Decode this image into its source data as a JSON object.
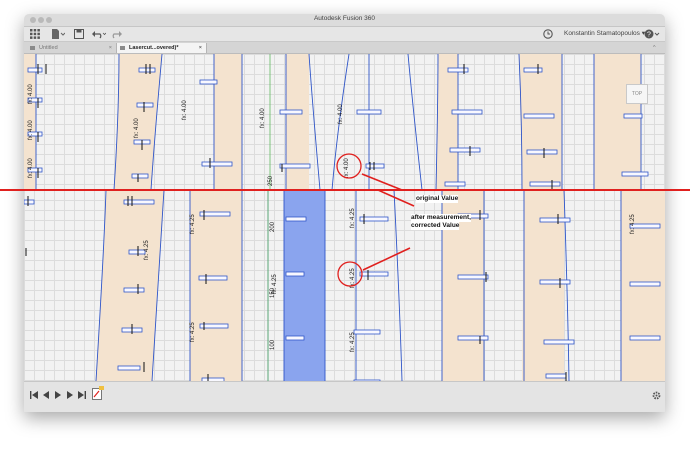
{
  "window": {
    "title": "Autodesk Fusion 360"
  },
  "toolbar": {
    "grid_icon": "grid-icon",
    "file_icon": "file-icon",
    "save_icon": "save-icon",
    "undo_icon": "undo-icon",
    "redo_icon": "redo-icon",
    "clock_icon": "clock-icon",
    "user_name": "Konstantin Stamatopoulos ▾",
    "help_icon": "help-icon"
  },
  "tabs": [
    {
      "label": "Untitled",
      "active": false
    },
    {
      "label": "Lasercut...overed)*",
      "active": true
    }
  ],
  "tab_close": "×",
  "tab_overflow": "^",
  "viewcube": {
    "label": "TOP"
  },
  "annotations": {
    "original": "original Value",
    "corrected_line1": "after measurement,",
    "corrected_line2": "corrected Value"
  },
  "dimensions": {
    "top": [
      "fx: 4.00",
      "fx: 4.00",
      "fx: 4.00",
      "fx: 4.00",
      "fx: 4.00",
      "fx: 4.00",
      "fx: 4.00",
      "fx: 4.00",
      "250"
    ],
    "bottom": [
      "fx: 4.25",
      "fx: 4.25",
      "fx: 4.25",
      "fx: 4.25",
      "fx: 4.25",
      "fx: 4.25",
      "fx: 4.25",
      "fx: 4.25",
      "200",
      "150",
      "100"
    ]
  },
  "colors": {
    "accent_red": "#e0201e",
    "highlight_blue": "#8aa4ee",
    "sketch_line": "#2f55c8",
    "tan_region": "#f4e3cf"
  }
}
